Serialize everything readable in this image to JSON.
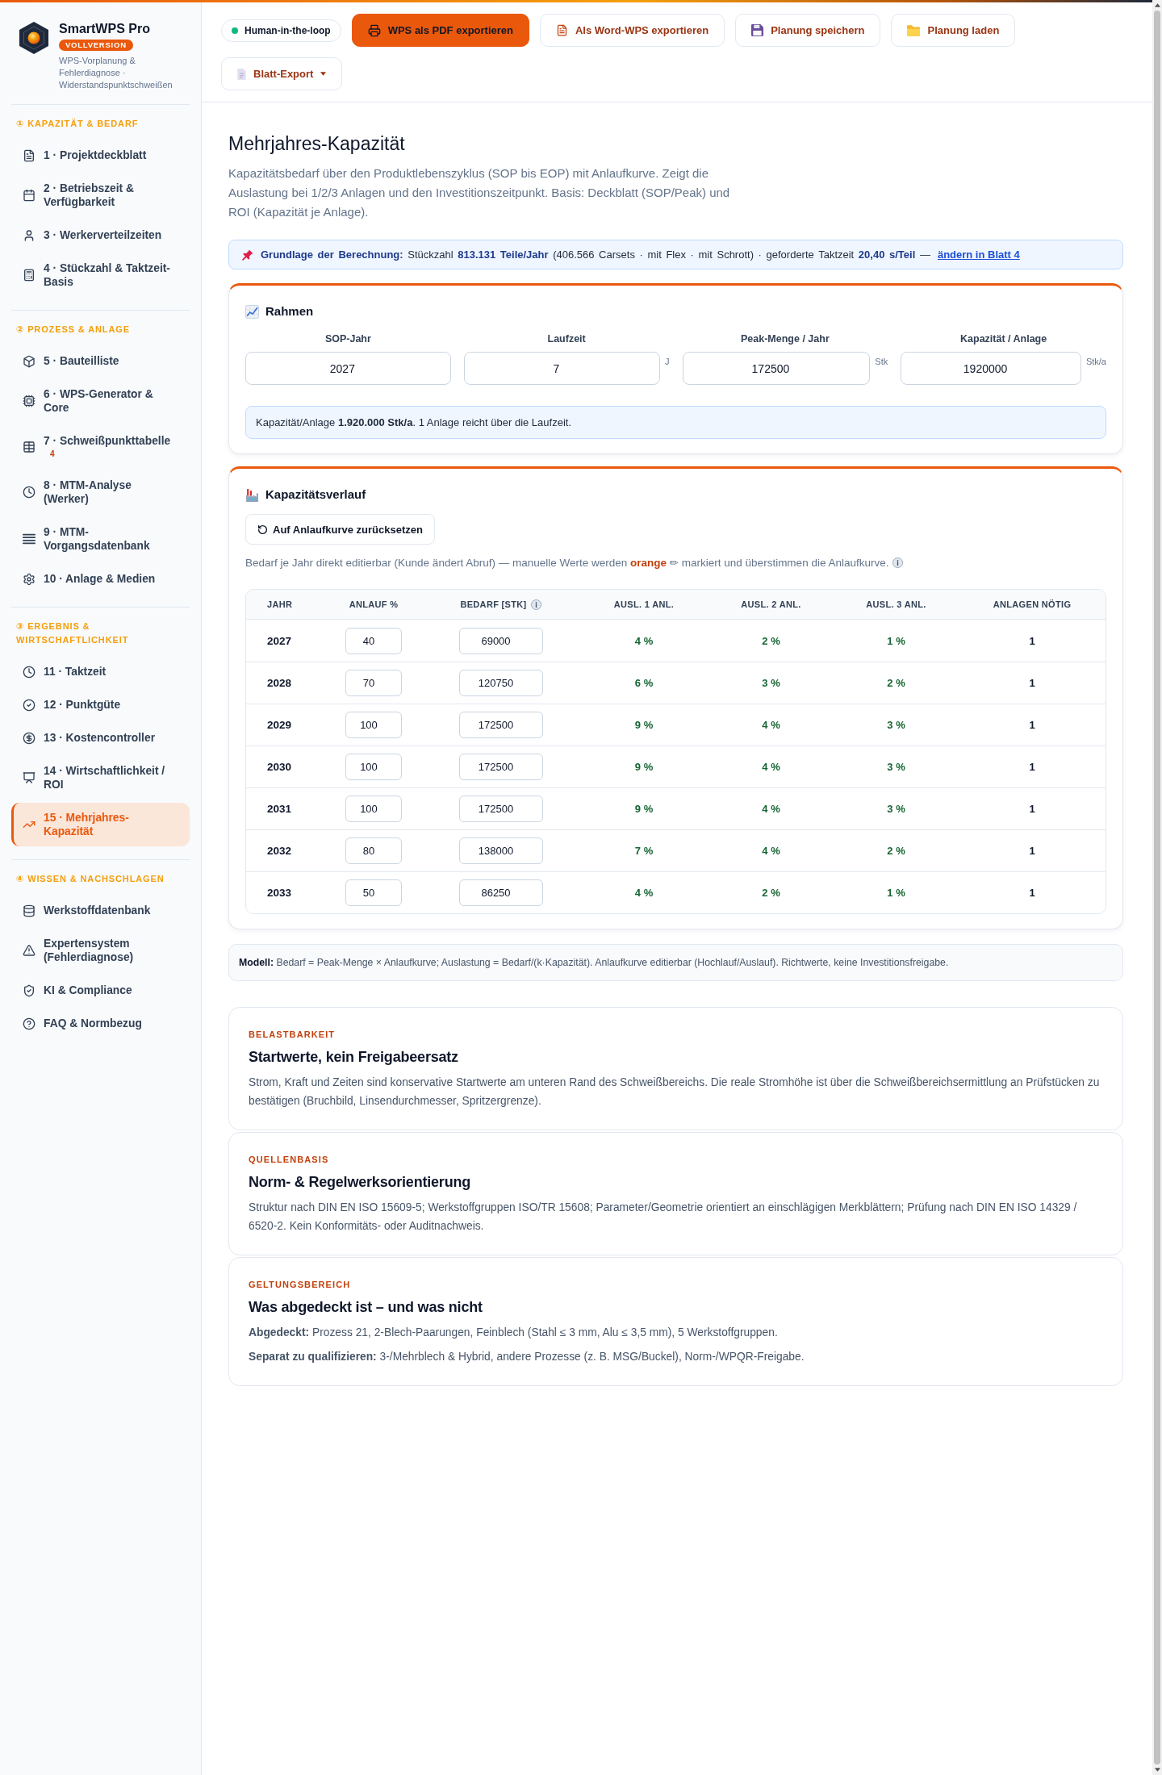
{
  "sidebar": {
    "brand": {
      "name": "SmartWPS Pro",
      "badge": "VOLLVERSION",
      "subtitle": "WPS-Vorplanung & Fehlerdiagnose · Widerstandspunktschweißen"
    },
    "sections": [
      {
        "title": "① KAPAZITÄT & BEDARF",
        "items": [
          {
            "label": "1 · Projektdeckblatt",
            "selected": false
          },
          {
            "label": "2 · Betriebszeit & Verfügbarkeit",
            "selected": false
          },
          {
            "label": "3 · Werkerverteilzeiten",
            "selected": false
          },
          {
            "label": "4 · Stückzahl & Taktzeit-Basis",
            "selected": false
          }
        ]
      },
      {
        "title": "② PROZESS & ANLAGE",
        "items": [
          {
            "label": "5 · Bauteilliste",
            "selected": false
          },
          {
            "label": "6 · WPS-Generator & Core",
            "selected": false
          },
          {
            "label": "7 · Schweißpunkttabelle",
            "selected": false,
            "badge": "4"
          },
          {
            "label": "8 · MTM-Analyse (Werker)",
            "selected": false
          },
          {
            "label": "9 · MTM-Vorgangsdatenbank",
            "selected": false
          },
          {
            "label": "10 · Anlage & Medien",
            "selected": false
          }
        ]
      },
      {
        "title": "③ ERGEBNIS & WIRTSCHAFTLICHKEIT",
        "items": [
          {
            "label": "11 · Taktzeit",
            "selected": false
          },
          {
            "label": "12 · Punktgüte",
            "selected": false
          },
          {
            "label": "13 · Kostencontroller",
            "selected": false
          },
          {
            "label": "14 · Wirtschaftlichkeit / ROI",
            "selected": false
          },
          {
            "label": "15 · Mehrjahres-Kapazität",
            "selected": true
          }
        ]
      },
      {
        "title": "④ WISSEN & NACHSCHLAGEN",
        "items": [
          {
            "label": "Werkstoffdatenbank",
            "selected": false
          },
          {
            "label": "Expertensystem (Fehlerdiagnose)",
            "selected": false
          },
          {
            "label": "KI & Compliance",
            "selected": false
          },
          {
            "label": "FAQ & Normbezug",
            "selected": false
          }
        ]
      }
    ]
  },
  "toolbar": {
    "items": [
      {
        "kind": "status",
        "label": "Human-in-the-loop"
      },
      {
        "kind": "primary",
        "label": "WPS als PDF exportieren"
      },
      {
        "kind": "secondary",
        "label": "Als Word-WPS exportieren"
      },
      {
        "kind": "secondary",
        "label": "Planung speichern"
      },
      {
        "kind": "secondary",
        "label": "Planung laden"
      },
      {
        "kind": "dropdown",
        "label": "Blatt-Export"
      }
    ]
  },
  "page": {
    "title": "Mehrjahres-Kapazität",
    "description": "Kapazitätsbedarf über den Produktlebenszyklus (SOP bis EOP) mit Anlaufkurve. Zeigt die Auslastung bei 1/2/3 Anlagen und den Investitionszeitpunkt. Basis: Deckblatt (SOP/Peak) und ROI (Kapazität je Anlage)."
  },
  "basis_banner": {
    "text": "**Grundlage der Berechnung:** Stückzahl **813.131 Teile/Jahr** (406.566 Carsets · mit Flex · mit Schrott) · geforderte Taktzeit **20,40 s/Teil** —",
    "link": "ändern in Blatt 4"
  },
  "rahmen": {
    "title": "Rahmen",
    "fields": [
      {
        "label": "SOP-Jahr",
        "value": "2027"
      },
      {
        "label": "Laufzeit",
        "value": "7",
        "unit": "J"
      },
      {
        "label": "Peak-Menge / Jahr",
        "value": "172500",
        "unit": "Stk"
      },
      {
        "label": "Kapazität / Anlage",
        "value": "1920000",
        "unit": "Stk/a"
      }
    ],
    "note": "Kapazität/Anlage **1.920.000 Stk/a**. 1 Anlage reicht über die Laufzeit."
  },
  "verlauf": {
    "title": "Kapazitätsverlauf",
    "reset_button": "Auf Anlaufkurve zurücksetzen",
    "note": "Bedarf je Jahr direkt editierbar (Kunde ändert Abruf) — manuelle Werte werden **orange** ✏ markiert und überstimmen die Anlaufkurve.",
    "table": {
      "columns": [
        {
          "label": "JAHR",
          "info": false
        },
        {
          "label": "ANLAUF %",
          "info": false
        },
        {
          "label": "BEDARF [STK]",
          "info": true
        },
        {
          "label": "AUSL. 1 ANL.",
          "info": false
        },
        {
          "label": "AUSL. 2 ANL.",
          "info": false
        },
        {
          "label": "AUSL. 3 ANL.",
          "info": false
        },
        {
          "label": "ANLAGEN NÖTIG",
          "info": false
        }
      ],
      "rows": [
        {
          "year": "2027",
          "ramp": "40",
          "demand": "69000",
          "util": [
            "4 %",
            "2 %",
            "1 %"
          ],
          "plants": "1"
        },
        {
          "year": "2028",
          "ramp": "70",
          "demand": "120750",
          "util": [
            "6 %",
            "3 %",
            "2 %"
          ],
          "plants": "1"
        },
        {
          "year": "2029",
          "ramp": "100",
          "demand": "172500",
          "util": [
            "9 %",
            "4 %",
            "3 %"
          ],
          "plants": "1"
        },
        {
          "year": "2030",
          "ramp": "100",
          "demand": "172500",
          "util": [
            "9 %",
            "4 %",
            "3 %"
          ],
          "plants": "1"
        },
        {
          "year": "2031",
          "ramp": "100",
          "demand": "172500",
          "util": [
            "9 %",
            "4 %",
            "3 %"
          ],
          "plants": "1"
        },
        {
          "year": "2032",
          "ramp": "80",
          "demand": "138000",
          "util": [
            "7 %",
            "4 %",
            "2 %"
          ],
          "plants": "1"
        },
        {
          "year": "2033",
          "ramp": "50",
          "demand": "86250",
          "util": [
            "4 %",
            "2 %",
            "1 %"
          ],
          "plants": "1"
        }
      ]
    }
  },
  "model_note": "**Modell:** Bedarf = Peak-Menge × Anlaufkurve; Auslastung = Bedarf/(k·Kapazität). Anlaufkurve editierbar (Hochlauf/Auslauf). Richtwerte, keine Investitionsfreigabe.",
  "info_cards": [
    {
      "kicker": "BELASTBARKEIT",
      "title": "Startwerte, kein Freigabeersatz",
      "paragraphs": [
        "Strom, Kraft und Zeiten sind konservative Startwerte am unteren Rand des Schweißbereichs. Die reale Stromhöhe ist über die Schweißbereichsermittlung an Prüfstücken zu bestätigen (Bruchbild, Linsendurchmesser, Spritzergrenze)."
      ]
    },
    {
      "kicker": "QUELLENBASIS",
      "title": "Norm- & Regelwerksorientierung",
      "paragraphs": [
        "Struktur nach DIN EN ISO 15609-5; Werkstoffgruppen ISO/TR 15608; Parameter/Geometrie orientiert an einschlägigen Merkblättern; Prüfung nach DIN EN ISO 14329 / 6520-2. Kein Konformitäts- oder Auditnachweis."
      ]
    },
    {
      "kicker": "GELTUNGSBEREICH",
      "title": "Was abgedeckt ist – und was nicht",
      "paragraphs": [
        "**Abgedeckt:** Prozess 21, 2-Blech-Paarungen, Feinblech (Stahl ≤ 3 mm, Alu ≤ 3,5 mm), 5 Werkstoffgruppen.",
        "**Separat zu qualifizieren:** 3-/Mehrblech & Hybrid, andere Prozesse (z. B. MSG/Buckel), Norm-/WPQR-Freigabe."
      ]
    }
  ]
}
